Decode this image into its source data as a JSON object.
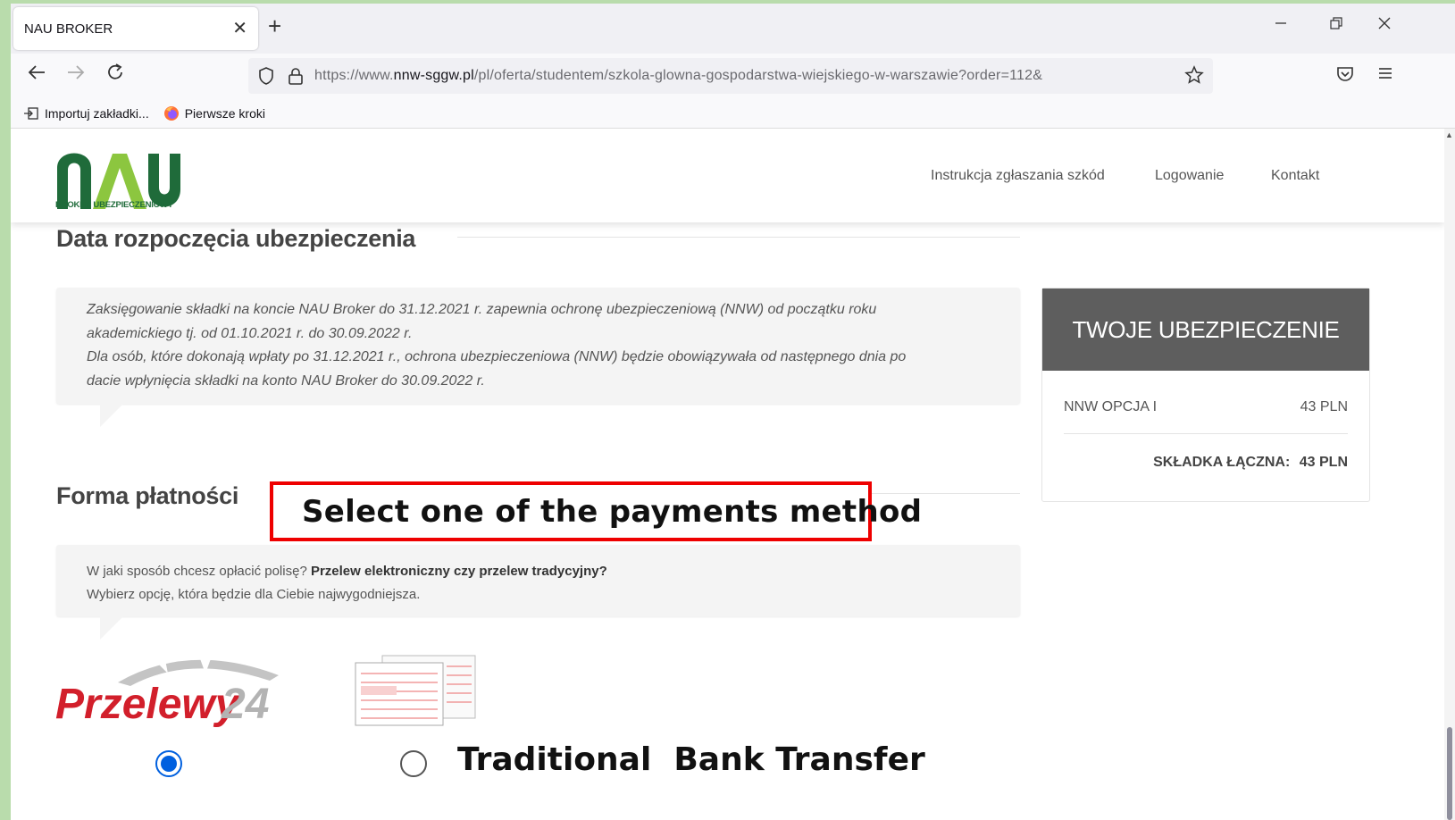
{
  "browser": {
    "tab_title": "NAU BROKER",
    "tab_close": "✕",
    "new_tab": "+",
    "url_prefix": "https://www.",
    "url_host": "nnw-sggw.pl",
    "url_path": "/pl/oferta/studentem/szkola-glowna-gospodarstwa-wiejskiego-w-warszawie?order=112&",
    "bookmarks": [
      {
        "icon": "import-icon",
        "label": "Importuj zakładki..."
      },
      {
        "icon": "firefox-icon",
        "label": "Pierwsze kroki"
      }
    ]
  },
  "site": {
    "logo_text": "NAU",
    "logo_subtitle": "BROKER UBEZPIECZENIOWY",
    "menu": [
      "Instrukcja zgłaszania szkód",
      "Logowanie",
      "Kontakt"
    ],
    "brand_green": "#1f6b3a",
    "brand_light_green": "#8cc63f"
  },
  "start_section": {
    "title": "Data rozpoczęcia ubezpieczenia",
    "lines": [
      "Zaksięgowanie składki na koncie NAU Broker do 31.12.2021 r. zapewnia ochronę ubezpieczeniową (NNW) od początku roku",
      "akademickiego tj. od 01.10.2021 r. do 30.09.2022 r.",
      "Dla osób, które dokonają wpłaty po 31.12.2021 r., ochrona ubezpieczeniowa (NNW) będzie obowiązywała od następnego dnia po",
      "dacie wpłynięcia składki na konto NAU Broker do 30.09.2022 r."
    ]
  },
  "summary": {
    "title": "TWOJE UBEZPIECZENIE",
    "item_label": "NNW OPCJA I",
    "item_value": "43 PLN",
    "total_label": "SKŁADKA ŁĄCZNA:",
    "total_value": "43 PLN"
  },
  "payment_section": {
    "title": "Forma płatności",
    "question_plain": "W jaki sposób chcesz opłacić polisę? ",
    "question_bold": "Przelew elektroniczny czy przelew tradycyjny?",
    "hint": "Wybierz opcję, która będzie dla Ciebie najwygodniejsza.",
    "p24_logo_text": "Przelewy",
    "p24_logo_num": "24",
    "p24_selected": true,
    "traditional_selected": false
  },
  "annotations": {
    "highlight_text": "Select one of the payments method",
    "traditional_label": "Traditional  Bank Transfer",
    "highlight_color": "#ee0000"
  }
}
